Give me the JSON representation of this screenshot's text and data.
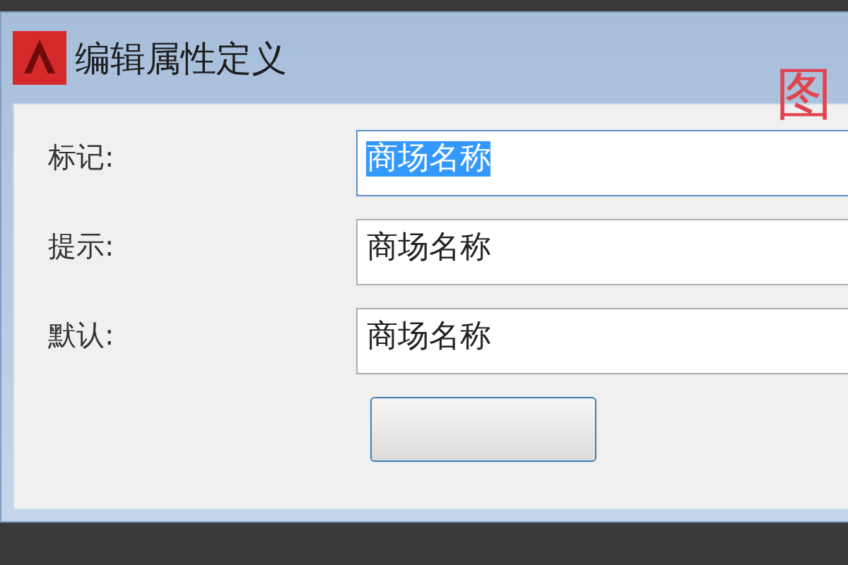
{
  "window": {
    "title": "编辑属性定义"
  },
  "annotation": "图",
  "fields": [
    {
      "label": "标记:",
      "value": "商场名称",
      "selected": true
    },
    {
      "label": "提示:",
      "value": "商场名称",
      "selected": false
    },
    {
      "label": "默认:",
      "value": "商场名称",
      "selected": false
    }
  ],
  "buttons": [
    {
      "kind": "ok"
    }
  ]
}
